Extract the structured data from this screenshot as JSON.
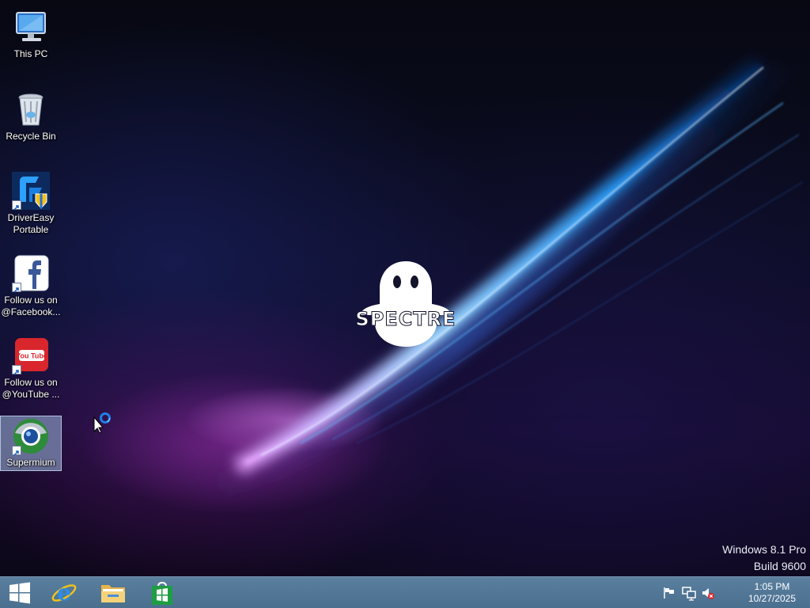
{
  "desktop": {
    "icons": [
      {
        "label": "This PC",
        "icon": "computer-icon"
      },
      {
        "label": "Recycle Bin",
        "icon": "recycle-bin-icon"
      },
      {
        "label": "DriverEasy Portable",
        "icon": "drivereasy-icon"
      },
      {
        "label": "Follow us on @Facebook...",
        "icon": "facebook-icon"
      },
      {
        "label": "Follow us on @YouTube ...",
        "icon": "youtube-icon"
      },
      {
        "label": "Supermium",
        "icon": "supermium-icon"
      }
    ],
    "youtube_badge": "You Tube",
    "logo_text": "SPECTRE",
    "watermark": {
      "line1": "Windows 8.1 Pro",
      "line2": "Build 9600"
    }
  },
  "taskbar": {
    "pinned": [
      {
        "name": "start-button",
        "icon": "windows-logo-icon"
      },
      {
        "name": "internet-explorer",
        "icon": "ie-icon"
      },
      {
        "name": "file-explorer",
        "icon": "folder-icon"
      },
      {
        "name": "windows-store",
        "icon": "store-icon"
      }
    ],
    "tray": [
      "action-center-flag-icon",
      "network-icon",
      "volume-muted-icon"
    ],
    "clock": {
      "time": "1:05 PM",
      "date": "10/27/2025"
    }
  },
  "colors": {
    "taskbar": "#4a6f8f",
    "selection": "#a0bee1",
    "store_green": "#1e9d43"
  }
}
